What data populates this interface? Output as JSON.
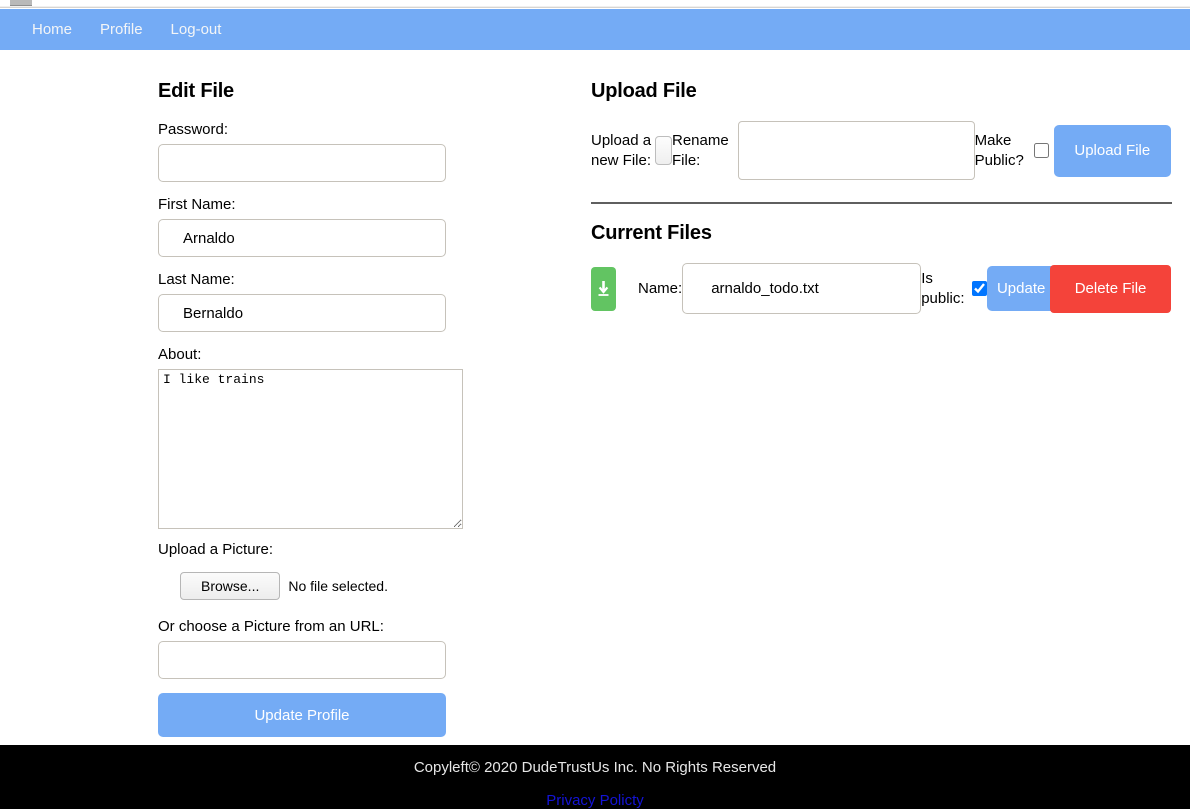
{
  "nav": {
    "items": [
      {
        "label": "Home"
      },
      {
        "label": "Profile"
      },
      {
        "label": "Log-out"
      }
    ],
    "background_color": "#74abf5"
  },
  "edit_file": {
    "heading": "Edit File",
    "password": {
      "label": "Password:",
      "value": "",
      "placeholder": ""
    },
    "first_name": {
      "label": "First Name:",
      "value": "Arnaldo",
      "placeholder": ""
    },
    "last_name": {
      "label": "Last Name:",
      "value": "Bernaldo",
      "placeholder": ""
    },
    "about": {
      "label": "About:",
      "value": "I like trains",
      "placeholder": ""
    },
    "upload_picture": {
      "label": "Upload a Picture:",
      "browse_label": "Browse...",
      "status": "No file selected."
    },
    "picture_url": {
      "label": "Or choose a Picture from an URL:",
      "value": "",
      "placeholder": ""
    },
    "submit_label": "Update Profile"
  },
  "upload_file": {
    "heading": "Upload File",
    "upload_new_label": "Upload a new File:",
    "rename_label": "Rename File:",
    "rename_value": "",
    "rename_placeholder": "",
    "make_public_label": "Make Public?",
    "make_public_checked": false,
    "button_label": "Upload File"
  },
  "current_files": {
    "heading": "Current Files",
    "rows": [
      {
        "download_icon": "download-icon",
        "name_label": "Name:",
        "name_value": "arnaldo_todo.txt",
        "is_public_label": "Is public:",
        "is_public_checked": true,
        "update_label": "Update",
        "delete_label": "Delete File"
      }
    ]
  },
  "footer": {
    "copyright": "Copyleft© 2020 DudeTrustUs Inc. No Rights Reserved",
    "privacy_link": "Privacy Policty"
  },
  "colors": {
    "primary": "#74abf5",
    "danger": "#f4433a",
    "success": "#62c462",
    "footer_bg": "#000000",
    "link": "#1414d6"
  }
}
